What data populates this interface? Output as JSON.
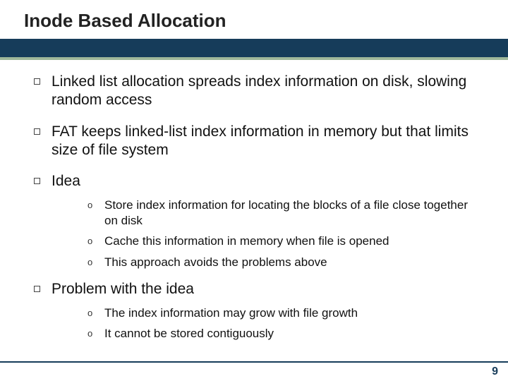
{
  "title": "Inode Based Allocation",
  "bullets": [
    {
      "text": "Linked list allocation spreads index information on disk, slowing random access",
      "sub": []
    },
    {
      "text": "FAT keeps linked-list index information in memory but that limits size of file system",
      "sub": []
    },
    {
      "text": "Idea",
      "sub": [
        "Store index information for locating the blocks of a file close together on disk",
        "Cache this information in memory when file is opened",
        "This approach avoids the problems above"
      ]
    },
    {
      "text": "Problem with the idea",
      "sub": [
        "The index information may grow with file growth",
        "It cannot be stored contiguously"
      ]
    }
  ],
  "sub_marker": "o",
  "page_number": "9"
}
